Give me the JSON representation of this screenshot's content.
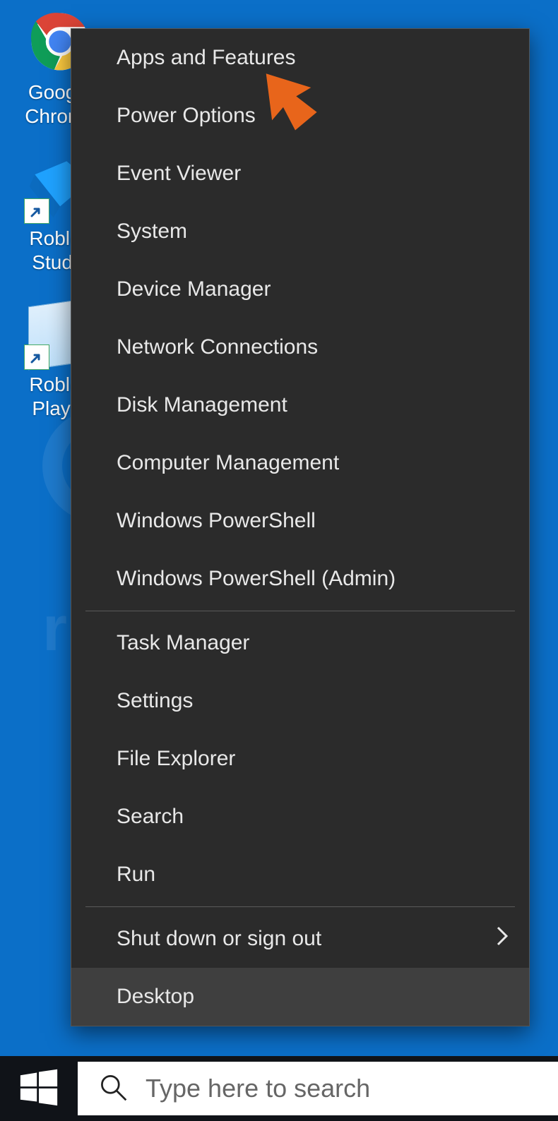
{
  "desktop": {
    "icons": [
      {
        "name": "google-chrome",
        "label": "Google Chrome"
      },
      {
        "name": "roblox-studio",
        "label": "Roblox Studio"
      },
      {
        "name": "roblox-player",
        "label": "Roblox Player"
      }
    ]
  },
  "menu": {
    "groups": [
      [
        {
          "id": "apps-features",
          "label": "Apps and Features"
        },
        {
          "id": "power-options",
          "label": "Power Options"
        },
        {
          "id": "event-viewer",
          "label": "Event Viewer"
        },
        {
          "id": "system",
          "label": "System"
        },
        {
          "id": "device-manager",
          "label": "Device Manager"
        },
        {
          "id": "network-connections",
          "label": "Network Connections"
        },
        {
          "id": "disk-management",
          "label": "Disk Management"
        },
        {
          "id": "computer-management",
          "label": "Computer Management"
        },
        {
          "id": "windows-powershell",
          "label": "Windows PowerShell"
        },
        {
          "id": "windows-powershell-admin",
          "label": "Windows PowerShell (Admin)"
        }
      ],
      [
        {
          "id": "task-manager",
          "label": "Task Manager"
        },
        {
          "id": "settings",
          "label": "Settings"
        },
        {
          "id": "file-explorer",
          "label": "File Explorer"
        },
        {
          "id": "search",
          "label": "Search"
        },
        {
          "id": "run",
          "label": "Run"
        }
      ],
      [
        {
          "id": "shut-down-sign-out",
          "label": "Shut down or sign out",
          "submenu": true
        },
        {
          "id": "desktop",
          "label": "Desktop",
          "hover": true
        }
      ]
    ]
  },
  "taskbar": {
    "search_placeholder": "Type here to search"
  },
  "watermark": {
    "text": "risk.com"
  },
  "colors": {
    "desktop_bg": "#0b6fc8",
    "menu_bg": "#2b2b2b",
    "menu_hover": "#3f3f3f",
    "menu_text": "#e8e8e8",
    "annotation_arrow": "#e8651b"
  }
}
